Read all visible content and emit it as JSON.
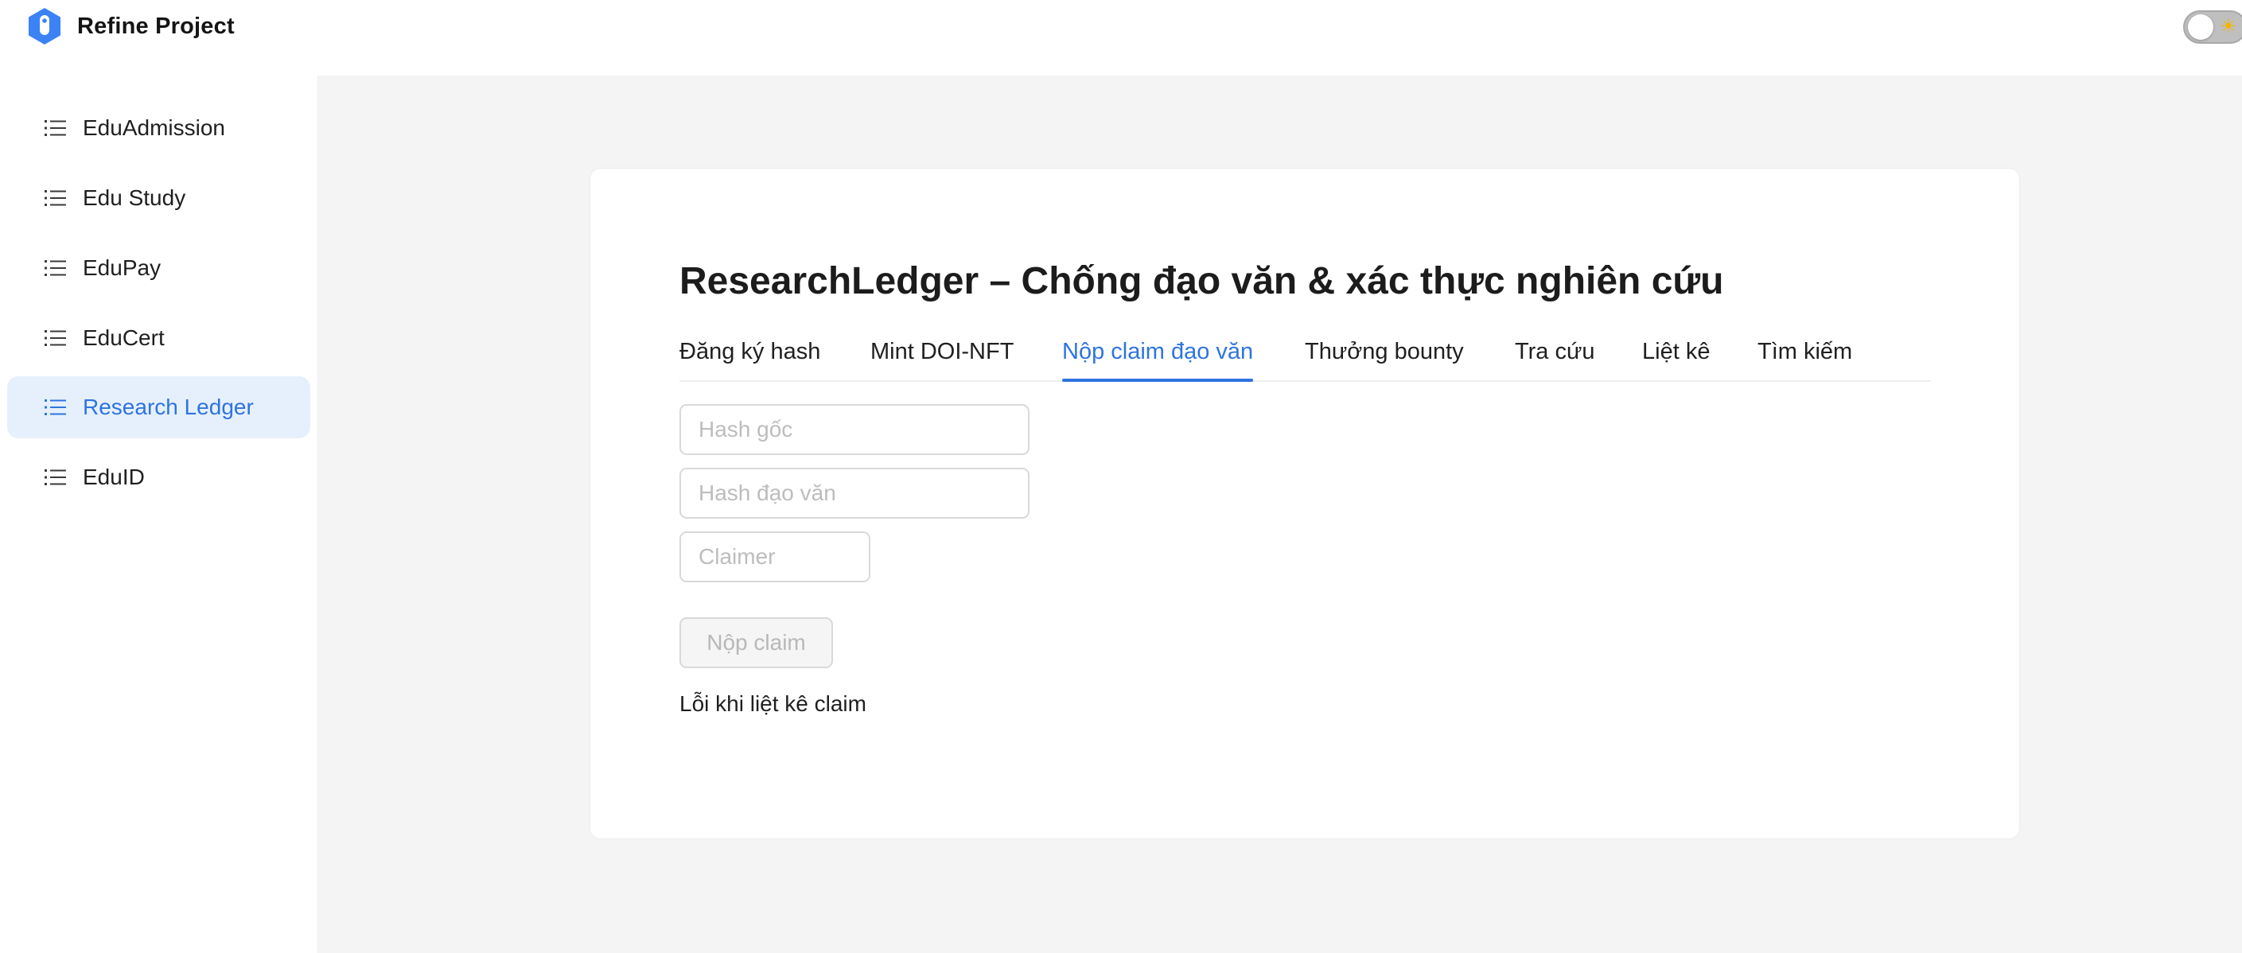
{
  "app": {
    "title": "Refine Project"
  },
  "theme_toggle": {
    "state": "light",
    "icon": "sun-icon"
  },
  "sidebar": {
    "items": [
      {
        "label": "EduAdmission",
        "icon": "list-icon",
        "active": false
      },
      {
        "label": "Edu Study",
        "icon": "list-icon",
        "active": false
      },
      {
        "label": "EduPay",
        "icon": "list-icon",
        "active": false
      },
      {
        "label": "EduCert",
        "icon": "list-icon",
        "active": false
      },
      {
        "label": "Research Ledger",
        "icon": "list-icon",
        "active": true
      },
      {
        "label": "EduID",
        "icon": "list-icon",
        "active": false
      }
    ]
  },
  "main": {
    "title": "ResearchLedger – Chống đạo văn & xác thực nghiên cứu",
    "tabs": [
      {
        "label": "Đăng ký hash",
        "active": false
      },
      {
        "label": "Mint DOI-NFT",
        "active": false
      },
      {
        "label": "Nộp claim đạo văn",
        "active": true
      },
      {
        "label": "Thưởng bounty",
        "active": false
      },
      {
        "label": "Tra cứu",
        "active": false
      },
      {
        "label": "Liệt kê",
        "active": false
      },
      {
        "label": "Tìm kiếm",
        "active": false
      }
    ],
    "form": {
      "original_hash": {
        "value": "",
        "placeholder": "Hash gốc"
      },
      "plagiarized_hash": {
        "value": "",
        "placeholder": "Hash đạo văn"
      },
      "claimer": {
        "value": "",
        "placeholder": "Claimer"
      },
      "submit_label": "Nộp claim",
      "submit_disabled": true
    },
    "error_message": "Lỗi khi liệt kê claim"
  },
  "colors": {
    "accent": "#2e74e0",
    "active_bg": "#e6f0fd",
    "content_bg": "#f4f4f4",
    "logo": "#3b82f6"
  }
}
